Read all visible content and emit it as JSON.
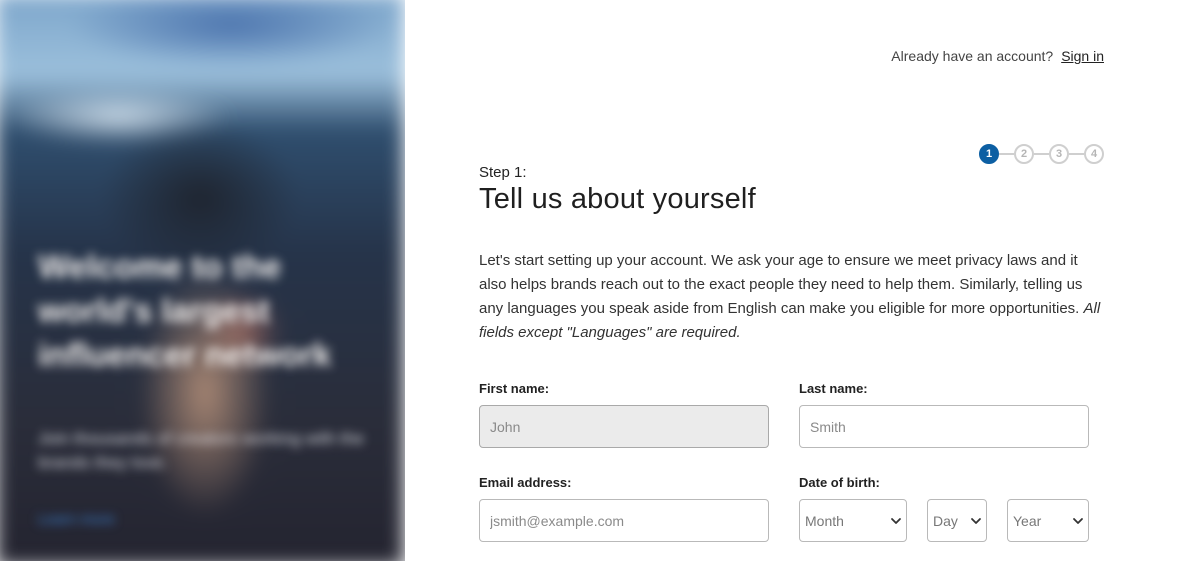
{
  "hero": {
    "headline": "Welcome to the world's largest influencer network",
    "subtext": "Join thousands of creators working with the brands they love.",
    "link": "Learn more"
  },
  "header": {
    "prompt": "Already have an account?",
    "signin_label": "Sign in"
  },
  "stepper": {
    "current_step": 1,
    "steps": [
      "1",
      "2",
      "3",
      "4"
    ],
    "active_color": "#0c5fa3"
  },
  "form": {
    "step_label": "Step 1:",
    "title": "Tell us about yourself",
    "intro": "Let's start setting up your account. We ask your age to ensure we meet privacy laws and it also helps brands reach out to the exact people they need to help them. Similarly, telling us any languages you speak aside from English can make you eligible for more opportunities.",
    "intro_note": "All fields except \"Languages\" are required.",
    "first_name": {
      "label": "First name:",
      "placeholder": "John",
      "value": ""
    },
    "last_name": {
      "label": "Last name:",
      "placeholder": "Smith",
      "value": ""
    },
    "email": {
      "label": "Email address:",
      "placeholder": "jsmith@example.com",
      "value": ""
    },
    "dob": {
      "label": "Date of birth:",
      "month": "Month",
      "day": "Day",
      "year": "Year"
    }
  }
}
